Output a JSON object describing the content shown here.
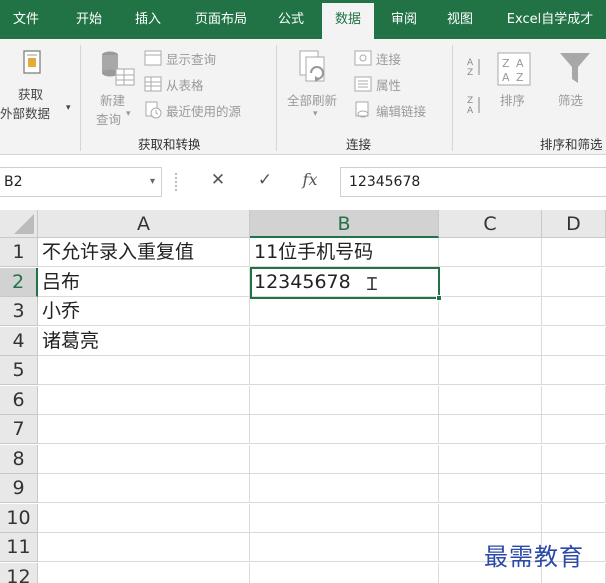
{
  "tabs": [
    {
      "label": "文件",
      "active": false
    },
    {
      "label": "开始",
      "active": false
    },
    {
      "label": "插入",
      "active": false
    },
    {
      "label": "页面布局",
      "active": false
    },
    {
      "label": "公式",
      "active": false
    },
    {
      "label": "数据",
      "active": true
    },
    {
      "label": "审阅",
      "active": false
    },
    {
      "label": "视图",
      "active": false
    },
    {
      "label": "Excel自学成才",
      "active": false
    }
  ],
  "ribbon": {
    "get_external": {
      "line1": "获取",
      "line2": "外部数据"
    },
    "new_query": {
      "line1": "新建",
      "line2": "查询"
    },
    "show_queries": "显示查询",
    "from_table": "从表格",
    "recent_sources": "最近使用的源",
    "group_get_transform": "获取和转换",
    "refresh_all": "全部刷新",
    "connections": "连接",
    "properties": "属性",
    "edit_links": "编辑链接",
    "group_connections": "连接",
    "sort": "排序",
    "filter": "筛选",
    "group_sort_filter": "排序和筛选"
  },
  "formula_bar": {
    "name_box": "B2",
    "cancel": "✕",
    "enter": "✓",
    "fx": "fx",
    "value": "12345678"
  },
  "grid": {
    "columns": [
      "A",
      "B",
      "C",
      "D"
    ],
    "rows": [
      "1",
      "2",
      "3",
      "4",
      "5",
      "6",
      "7",
      "8",
      "9",
      "10",
      "11",
      "12"
    ],
    "cells": [
      [
        "不允许录入重复值",
        "11位手机号码",
        "",
        ""
      ],
      [
        "吕布",
        "12345678",
        "",
        ""
      ],
      [
        "小乔",
        "",
        "",
        ""
      ],
      [
        "诸葛亮",
        "",
        "",
        ""
      ],
      [
        "",
        "",
        "",
        ""
      ],
      [
        "",
        "",
        "",
        ""
      ],
      [
        "",
        "",
        "",
        ""
      ],
      [
        "",
        "",
        "",
        ""
      ],
      [
        "",
        "",
        "",
        ""
      ],
      [
        "",
        "",
        "",
        ""
      ],
      [
        "",
        "",
        "",
        ""
      ],
      [
        "",
        "",
        "",
        ""
      ]
    ],
    "selected_cell": "B2"
  },
  "watermark": "最需教育",
  "colors": {
    "accent": "#217346",
    "watermark": "#2b4aa8"
  }
}
